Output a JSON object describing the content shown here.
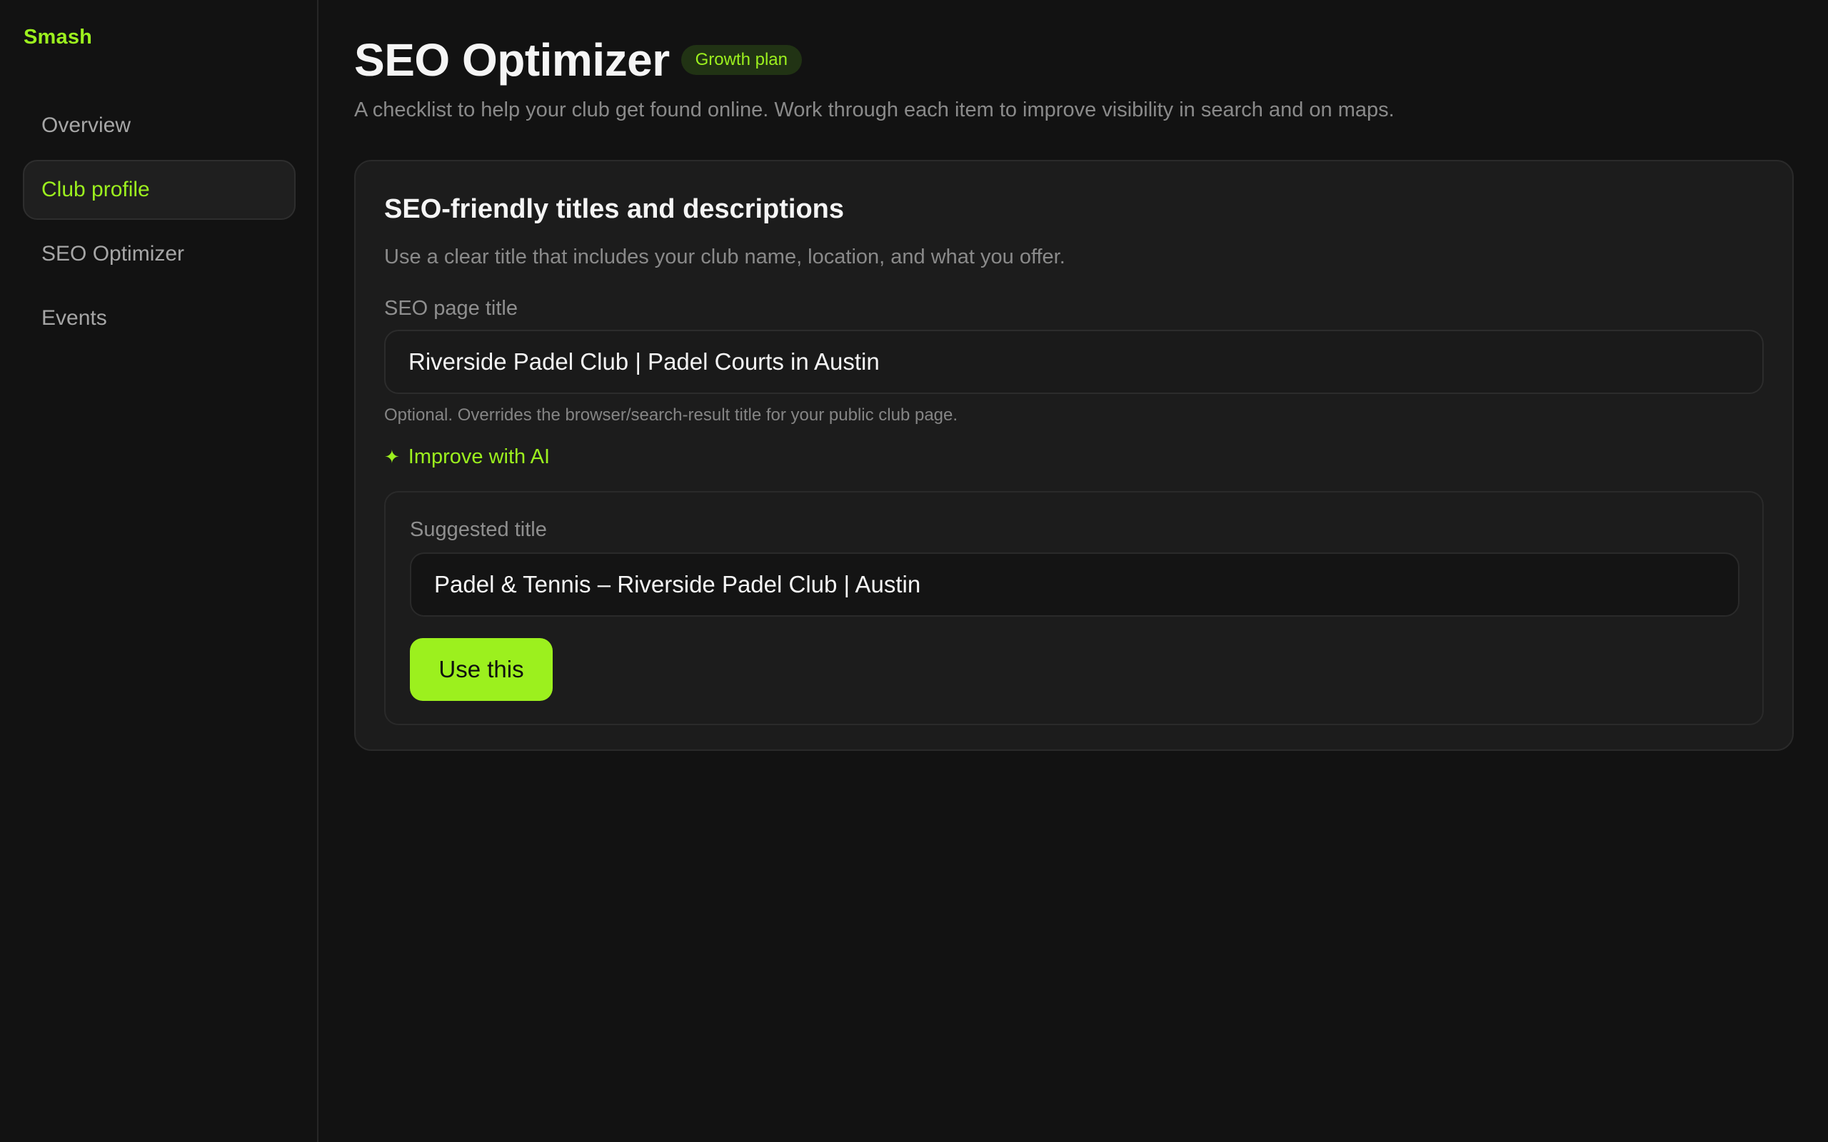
{
  "app": {
    "brand": "Smash"
  },
  "sidebar": {
    "items": [
      {
        "label": "Overview"
      },
      {
        "label": "Club profile"
      },
      {
        "label": "SEO Optimizer"
      },
      {
        "label": "Events"
      }
    ],
    "active_index": 1
  },
  "header": {
    "title": "SEO Optimizer",
    "badge": "Growth plan",
    "subtitle": "A checklist to help your club get found online. Work through each item to improve visibility in search and on maps."
  },
  "card": {
    "title": "SEO-friendly titles and descriptions",
    "description": "Use a clear title that includes your club name, location, and what you offer.",
    "field_label": "SEO page title",
    "field_value": "Riverside Padel Club | Padel Courts in Austin",
    "help_text": "Optional. Overrides the browser/search-result title for your public club page.",
    "ai_link_label": "Improve with AI",
    "ai_icon": "sparkle-icon",
    "suggestion": {
      "label": "Suggested title",
      "value": "Padel & Tennis – Riverside Padel Club | Austin",
      "button_label": "Use this"
    }
  },
  "colors": {
    "accent": "#9cf01e",
    "background": "#121212",
    "card": "#1c1c1c"
  }
}
